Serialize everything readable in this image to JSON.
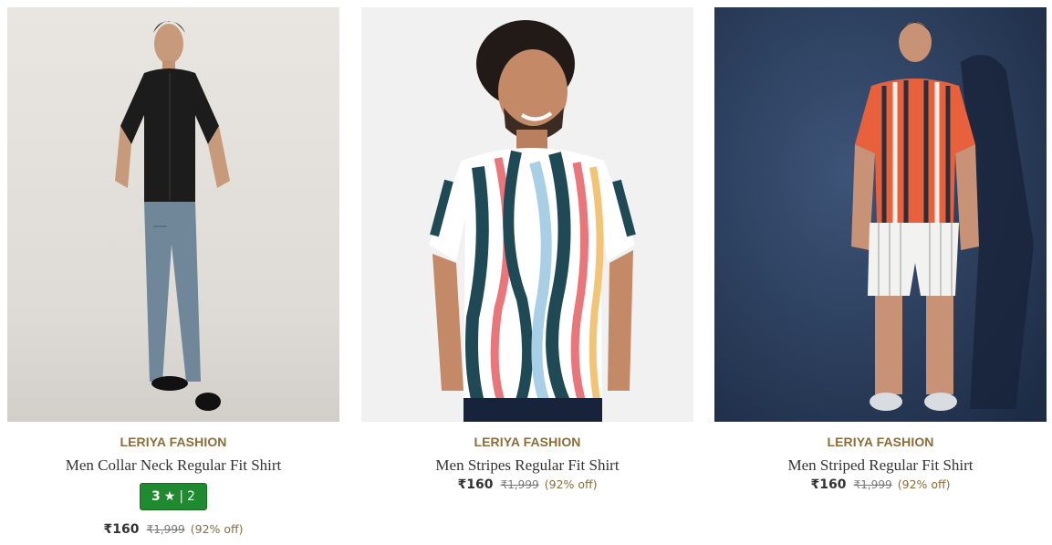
{
  "products": [
    {
      "brand": "LERIYA FASHION",
      "title": "Men Collar Neck Regular Fit Shirt",
      "rating": {
        "score": "3",
        "star": "★",
        "separator": "|",
        "count": "2"
      },
      "price": "₹160",
      "mrp": "₹1,999",
      "discount": "(92% off)",
      "image": {
        "background": "#e8e5e1",
        "shirt_color": "#1c1c1c",
        "pants_color": "#6f8799"
      }
    },
    {
      "brand": "LERIYA FASHION",
      "title": "Men Stripes Regular Fit Shirt",
      "price": "₹160",
      "mrp": "₹1,999",
      "discount": "(92% off)",
      "image": {
        "background": "#f1f1f1",
        "shirt_colors": [
          "#1f4a55",
          "#e8767a",
          "#a9cfe6",
          "#f2c478",
          "#ffffff"
        ]
      }
    },
    {
      "brand": "LERIYA FASHION",
      "title": "Men Striped Regular Fit Shirt",
      "price": "₹160",
      "mrp": "₹1,999",
      "discount": "(92% off)",
      "image": {
        "background": "#2a3f5f",
        "shirt_colors": [
          "#e8603c",
          "#2b2f3a",
          "#f4f1ec"
        ],
        "shorts_color": "#f2f2f0"
      }
    }
  ]
}
